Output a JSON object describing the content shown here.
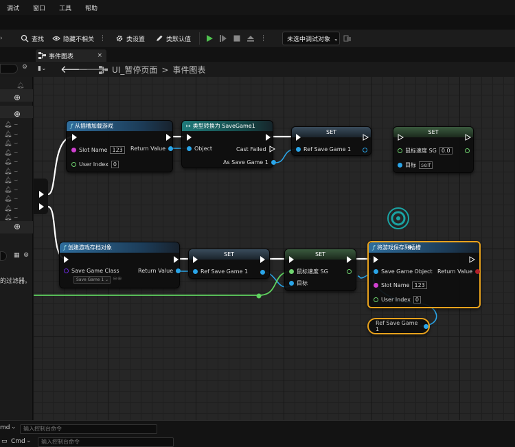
{
  "menu": [
    "调试",
    "窗口",
    "工具",
    "帮助"
  ],
  "toolbar": {
    "find": "查找",
    "hide_unrelated": "隐藏不相关",
    "class_settings": "类设置",
    "class_defaults": "类默认值",
    "debug_target": "未选中调试对象"
  },
  "tab": {
    "label": "事件图表"
  },
  "breadcrumb": {
    "root": "UI_暂停页面",
    "sep": ">",
    "current": "事件图表"
  },
  "left": {
    "filter_text": "的过滤器。"
  },
  "nodes": {
    "load": {
      "title": "从插槽加载游戏",
      "slot_name_label": "Slot Name",
      "slot_name_value": "123",
      "user_index_label": "User Index",
      "user_index_value": "0",
      "return_label": "Return Value"
    },
    "cast": {
      "title": "类型转换为 SaveGame1",
      "object_label": "Object",
      "cast_failed_label": "Cast Failed",
      "as_label": "As Save Game 1"
    },
    "set1": {
      "title": "SET",
      "var_label": "Ref Save Game 1"
    },
    "set2": {
      "title": "SET",
      "var_label": "鼠标速度 SG",
      "var_value": "0.0",
      "target_label": "目标",
      "target_value": "self"
    },
    "create": {
      "title": "创建游戏存档对象",
      "class_label": "Save Game Class",
      "class_value": "Save Game 1",
      "return_label": "Return Value"
    },
    "set3": {
      "title": "SET",
      "var_label": "Ref Save Game 1"
    },
    "set4": {
      "title": "SET",
      "var_label": "鼠标速度 SG",
      "target_label": "目标"
    },
    "save": {
      "title": "将游戏保存到插槽",
      "obj_label": "Save Game Object",
      "slot_name_label": "Slot Name",
      "slot_name_value": "123",
      "user_index_label": "User Index",
      "user_index_value": "0",
      "return_label": "Return Value"
    },
    "getref": {
      "label": "Ref Save Game 1"
    }
  },
  "console": {
    "cmd1": "md",
    "placeholder1": "输入控制台命令",
    "cmd2": "Cmd",
    "placeholder2": "输入控制台命令"
  }
}
